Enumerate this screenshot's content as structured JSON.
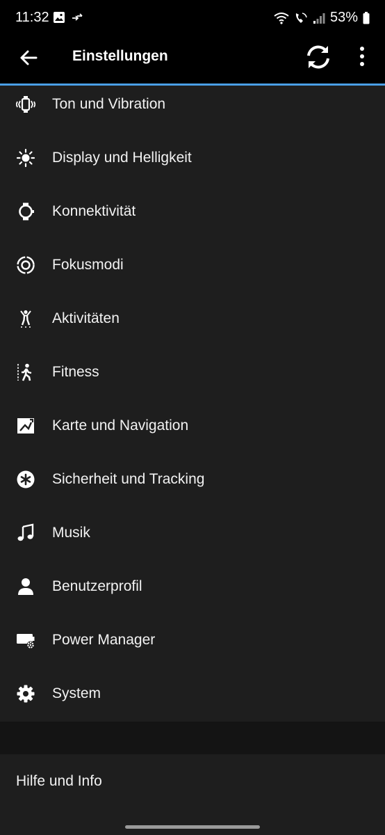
{
  "status_bar": {
    "time": "11:32",
    "battery": "53%"
  },
  "app_bar": {
    "title": "Einstellungen"
  },
  "settings": [
    {
      "label": "Ton und Vibration",
      "icon": "sound-vibration-icon"
    },
    {
      "label": "Display und Helligkeit",
      "icon": "brightness-icon"
    },
    {
      "label": "Konnektivität",
      "icon": "watch-connectivity-icon"
    },
    {
      "label": "Fokusmodi",
      "icon": "focus-icon"
    },
    {
      "label": "Aktivitäten",
      "icon": "activity-icon"
    },
    {
      "label": "Fitness",
      "icon": "fitness-icon"
    },
    {
      "label": "Karte und Navigation",
      "icon": "map-icon"
    },
    {
      "label": "Sicherheit und Tracking",
      "icon": "safety-icon"
    },
    {
      "label": "Musik",
      "icon": "music-icon"
    },
    {
      "label": "Benutzerprofil",
      "icon": "user-icon"
    },
    {
      "label": "Power Manager",
      "icon": "power-manager-icon"
    },
    {
      "label": "System",
      "icon": "gear-icon"
    }
  ],
  "help": {
    "label": "Hilfe und Info"
  },
  "colors": {
    "accent": "#4a9fe6",
    "list_background": "#1e1e1e",
    "bar_background": "#000000"
  }
}
